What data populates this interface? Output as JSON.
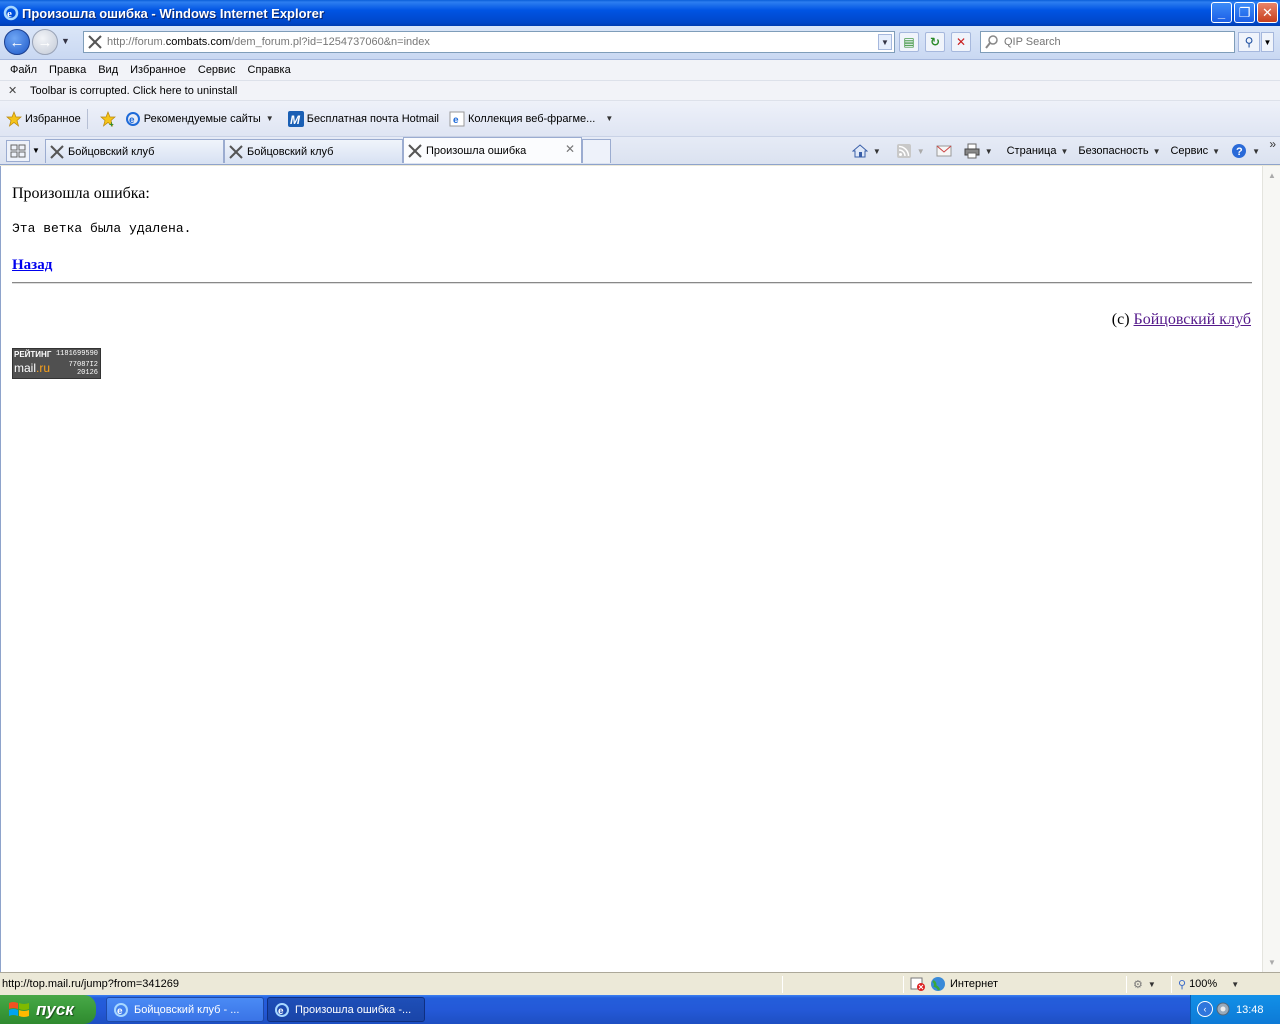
{
  "window": {
    "title": "Произошла ошибка - Windows Internet Explorer"
  },
  "nav": {
    "url_prefix": "http://forum.",
    "url_domain": "combats.com",
    "url_path": "/dem_forum.pl?id=1254737060&n=index",
    "search_placeholder": "QIP Search"
  },
  "menu": [
    "Файл",
    "Правка",
    "Вид",
    "Избранное",
    "Сервис",
    "Справка"
  ],
  "toolbar_warning": "Toolbar is corrupted. Click here to uninstall",
  "favorites": {
    "favorites_label": "Избранное",
    "items": [
      "Рекомендуемые сайты",
      "Бесплатная почта Hotmail",
      "Коллекция веб-фрагме..."
    ]
  },
  "tabs": [
    {
      "label": "Бойцовский клуб",
      "active": false
    },
    {
      "label": "Бойцовский клуб",
      "active": false
    },
    {
      "label": "Произошла ошибка",
      "active": true
    }
  ],
  "commands": {
    "page": "Страница",
    "safety": "Безопасность",
    "tools": "Сервис"
  },
  "content": {
    "error_title": "Произошла ошибка:",
    "error_message": "Эта ветка была удалена.",
    "back_link": "Назад",
    "copyright_prefix": "(c)",
    "copyright_link": "Бойцовский клуб"
  },
  "counter": {
    "label": "РЕЙТИНГ",
    "brand_main": "mail",
    "brand_suffix": ".ru",
    "num1": "1181699590",
    "num2": "77087I2",
    "num3": "20126"
  },
  "status": {
    "text": "http://top.mail.ru/jump?from=341269",
    "zone": "Интернет",
    "zoom": "100%"
  },
  "taskbar": {
    "start": "пуск",
    "tasks": [
      "Бойцовский клуб - ...",
      "Произошла ошибка -..."
    ],
    "clock": "13:48"
  },
  "colors": {
    "title_blue": "#0054e3",
    "link_blue": "#0000ee",
    "visited_link": "#551a8b",
    "start_green": "#3a9a3a"
  }
}
